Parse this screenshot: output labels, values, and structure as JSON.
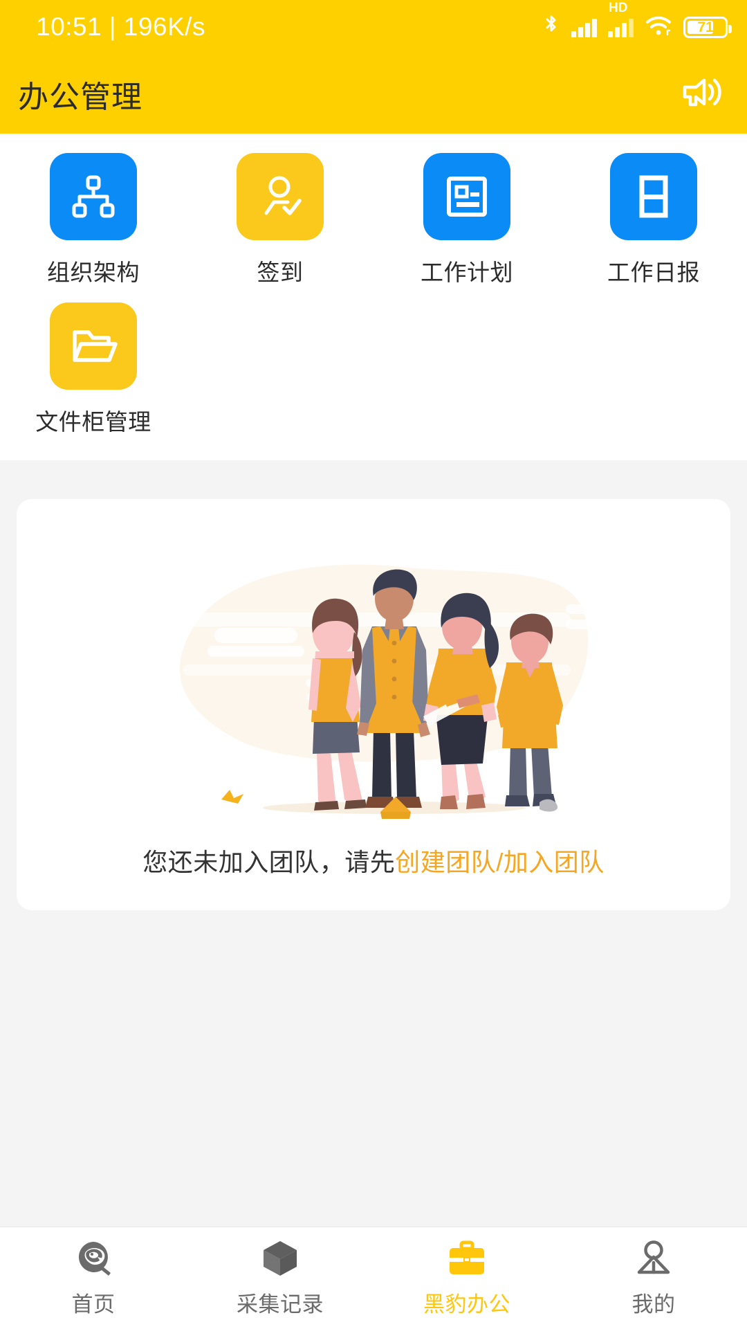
{
  "theme": {
    "brand_yellow": "#FFD000",
    "tile_blue": "#0A8BF5",
    "tile_yellow": "#FBC91B",
    "link_orange": "#F5A623",
    "active_tab": "#FFC60B",
    "page_bg": "#f4f4f4"
  },
  "status_bar": {
    "time": "10:51",
    "separator": "|",
    "network_speed": "196K/s",
    "left_text": "10:51 | 196K/s",
    "icons": [
      {
        "name": "bluetooth-icon",
        "label": "Bluetooth"
      },
      {
        "name": "signal-bars-icon",
        "label": "Signal"
      },
      {
        "name": "hd-signal-icon",
        "label": "HD"
      },
      {
        "name": "wifi-icon",
        "label": "Wi-Fi"
      },
      {
        "name": "battery-icon",
        "label": "Battery"
      }
    ],
    "hd_label": "HD",
    "battery_percent": "71"
  },
  "app_bar": {
    "title": "办公管理",
    "action_icon": "megaphone-icon"
  },
  "grid": {
    "items": [
      {
        "label": "组织架构",
        "icon": "org-chart-icon",
        "color": "#0A8BF5"
      },
      {
        "label": "签到",
        "icon": "check-in-icon",
        "color": "#FBC91B"
      },
      {
        "label": "工作计划",
        "icon": "work-plan-icon",
        "color": "#0A8BF5"
      },
      {
        "label": "工作日报",
        "icon": "daily-report-icon",
        "color": "#0A8BF5"
      },
      {
        "label": "文件柜管理",
        "icon": "folder-icon",
        "color": "#FBC91B"
      }
    ]
  },
  "empty_state": {
    "illustration": "team-illustration",
    "message_prefix": "您还未加入团队，请先",
    "message_link": "创建团队/加入团队"
  },
  "tab_bar": {
    "active_index": 2,
    "tabs": [
      {
        "label": "首页",
        "icon": "panther-home-icon"
      },
      {
        "label": "采集记录",
        "icon": "cube-box-icon"
      },
      {
        "label": "黑豹办公",
        "icon": "briefcase-icon"
      },
      {
        "label": "我的",
        "icon": "person-icon"
      }
    ]
  }
}
